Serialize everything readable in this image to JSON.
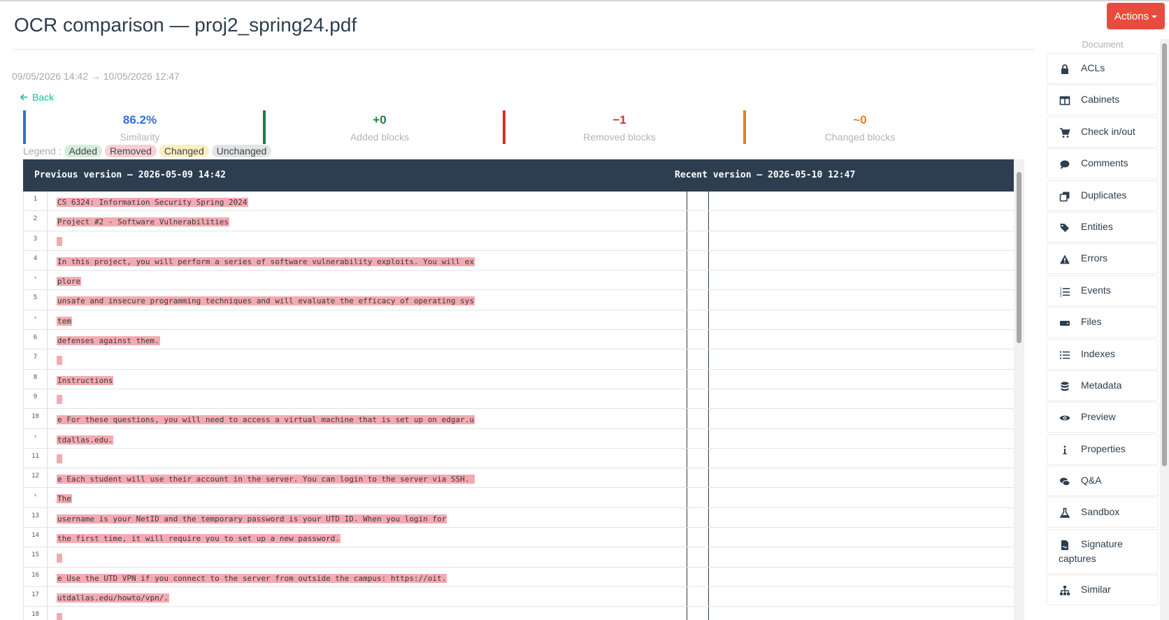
{
  "page": {
    "title": "OCR comparison — proj2_spring24.pdf",
    "timerange": "09/05/2026 14:42 → 10/05/2026 12:47",
    "back_label": "Back"
  },
  "stats": [
    {
      "value": "86.2%",
      "label": "Similarity",
      "color": "#2c6fdb"
    },
    {
      "value": "+0",
      "label": "Added blocks",
      "color": "#1e7e45"
    },
    {
      "value": "−1",
      "label": "Removed blocks",
      "color": "#d0332b"
    },
    {
      "value": "~0",
      "label": "Changed blocks",
      "color": "#e67e22"
    }
  ],
  "legend": {
    "label": "Legend :",
    "added": "Added",
    "removed": "Removed",
    "changed": "Changed",
    "unchanged": "Unchanged"
  },
  "diff": {
    "left_header": "Previous version — 2026-05-09 14:42",
    "right_header": "Recent version — 2026-05-10 12:47",
    "rows": [
      {
        "num": "1",
        "text": "CS 6324: Information Security Spring 2024"
      },
      {
        "num": "2",
        "text": "Project #2 - Software Vulnerabilities"
      },
      {
        "num": "3",
        "text": ""
      },
      {
        "num": "4",
        "text": "In this project, you will perform a series of software vulnerability exploits. You will ex"
      },
      {
        "num": "›",
        "text": "plore"
      },
      {
        "num": "5",
        "text": "unsafe and insecure programming techniques and will evaluate the efficacy of operating sys"
      },
      {
        "num": "›",
        "text": "tem"
      },
      {
        "num": "6",
        "text": "defenses against them."
      },
      {
        "num": "7",
        "text": ""
      },
      {
        "num": "8",
        "text": "Instructions"
      },
      {
        "num": "9",
        "text": ""
      },
      {
        "num": "10",
        "text": "e For these questions, you will need to access a virtual machine that is set up on edgar.u"
      },
      {
        "num": "›",
        "text": "tdallas.edu."
      },
      {
        "num": "11",
        "text": ""
      },
      {
        "num": "12",
        "text": "e Each student will use their account in the server. You can login to the server via SSH. "
      },
      {
        "num": "›",
        "text": "The"
      },
      {
        "num": "13",
        "text": "username is your NetID and the temporary password is your UTD ID. When you login for"
      },
      {
        "num": "14",
        "text": "the first time, it will require you to set up a new password."
      },
      {
        "num": "15",
        "text": ""
      },
      {
        "num": "16",
        "text": "e Use the UTD VPN if you connect to the server from outside the campus: https://oit."
      },
      {
        "num": "17",
        "text": "utdallas.edu/howto/vpn/."
      },
      {
        "num": "18",
        "text": ""
      }
    ]
  },
  "actions": {
    "label": "Actions"
  },
  "sidebar": {
    "heading": "Document",
    "items": [
      {
        "label": "ACLs",
        "icon": "lock-icon"
      },
      {
        "label": "Cabinets",
        "icon": "columns-icon"
      },
      {
        "label": "Check in/out",
        "icon": "cart-icon"
      },
      {
        "label": "Comments",
        "icon": "comment-icon"
      },
      {
        "label": "Duplicates",
        "icon": "clone-icon"
      },
      {
        "label": "Entities",
        "icon": "tags-icon"
      },
      {
        "label": "Errors",
        "icon": "warning-icon"
      },
      {
        "label": "Events",
        "icon": "list-ol-icon"
      },
      {
        "label": "Files",
        "icon": "hdd-icon"
      },
      {
        "label": "Indexes",
        "icon": "list-icon"
      },
      {
        "label": "Metadata",
        "icon": "database-icon"
      },
      {
        "label": "Preview",
        "icon": "eye-icon"
      },
      {
        "label": "Properties",
        "icon": "info-icon"
      },
      {
        "label": "Q&A",
        "icon": "comments-icon"
      },
      {
        "label": "Sandbox",
        "icon": "flask-icon"
      },
      {
        "label": "Signature captures",
        "icon": "signature-file-icon"
      },
      {
        "label": "Similar",
        "icon": "sitemap-icon"
      }
    ]
  }
}
